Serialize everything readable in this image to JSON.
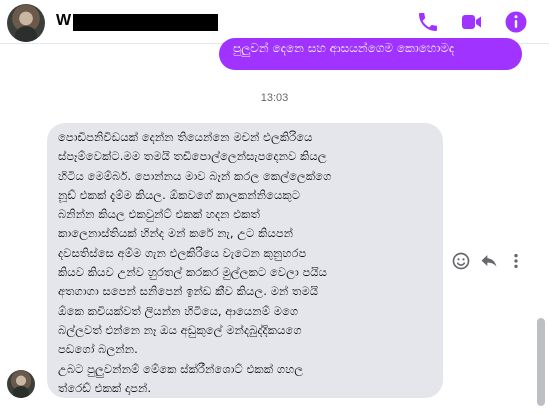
{
  "header": {
    "contact_name": "W",
    "icons": [
      "phone-icon",
      "video-camera-icon",
      "info-icon"
    ]
  },
  "conversation": {
    "sent_message": "පුලුවන් දෙනෙ සහ ආසයන්ගෙම කොහොමද",
    "timestamp": "13:03",
    "received_message": "පොඩිපනිවිඩයක් දෙන්න තියෙන්නෙ මචන් එලකිරියෙ\nස්පෑම්වෙක්ට.මම තමයි තඩිපොල්ලෙන්සැපදෙනව කියල\nහිටිය මෙම්බර්. පොන්නය මාව බෑන් කරල කෙල්ලෙක්ගෙ\nනූඩ් එකක් දැම්ම කියල. ඕකවගේ කාලකන්නියෙකුට\nබනින්න කියල එකවුන්ට් එකක් හදන එකත්\nකාලෙනාස්තියක් හින්ද මන් කරේ නැ, උට කියපන්\nදවසතිස්සෙ අම්ම ගැන එලකිරියෙ වැටෙන කුනුහරප\nකියව කියව උන්ව හුරතල් කරකර මුල්ලකට වෙලා පයිය\nඅතගාගා සපෙන් සනිපෙන් ඉන්ඩ කීව කියල. මන් තමයි\nඕකෙ කවියක්වත් ලියන්න හිටියෙ, ආයෙනම් මගෙ\nබල්ලවත් එන්නෙ නෑ ඔය අඩුකුලේ මන්දබුද්දිකයගෙ\nපඩගෝ බලන්න.\nඋබට පුලුවන්නම් මේකෙ ස්ක්රීන්ශොට් එකක් ගහල\nත්රෙඩ් එකක් දාපන්."
  },
  "message_actions": [
    "react-icon",
    "reply-icon",
    "more-icon"
  ],
  "colors": {
    "accent": "#a033ff",
    "received_bubble": "#e4e6eb",
    "timestamp": "#65676b"
  }
}
